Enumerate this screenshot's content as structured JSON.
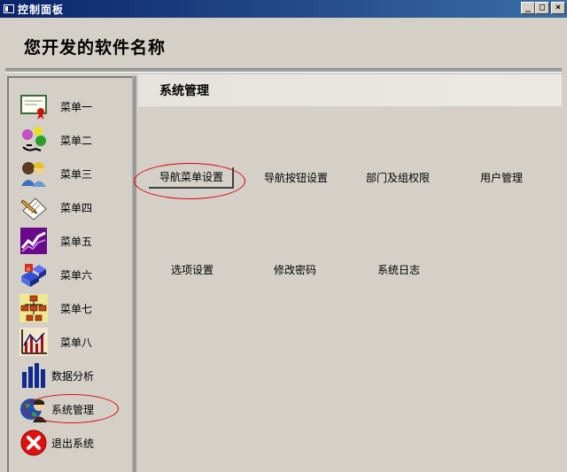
{
  "window": {
    "title": "控制面板"
  },
  "window_buttons": {
    "minimize": "_",
    "maximize": "□",
    "close": "×"
  },
  "header": {
    "app_name": "您开发的软件名称"
  },
  "sidebar": {
    "items": [
      {
        "label": "菜单一",
        "icon": "certificate-icon"
      },
      {
        "label": "菜单二",
        "icon": "colored-balls-icon"
      },
      {
        "label": "菜单三",
        "icon": "people-icon"
      },
      {
        "label": "菜单四",
        "icon": "notepad-pencil-icon"
      },
      {
        "label": "菜单五",
        "icon": "trend-chart-icon"
      },
      {
        "label": "菜单六",
        "icon": "blocks-icon"
      },
      {
        "label": "菜单七",
        "icon": "org-chart-icon"
      },
      {
        "label": "菜单八",
        "icon": "bar-chart-icon"
      },
      {
        "label": "数据分析",
        "icon": "bars-icon"
      },
      {
        "label": "系统管理",
        "icon": "globe-person-icon"
      },
      {
        "label": "退出系统",
        "icon": "exit-x-icon"
      }
    ]
  },
  "main": {
    "title": "系统管理",
    "row1": [
      "导航菜单设置",
      "导航按钮设置",
      "部门及组权限",
      "用户管理"
    ],
    "row2": [
      "选项设置",
      "修改密码",
      "系统日志"
    ]
  }
}
